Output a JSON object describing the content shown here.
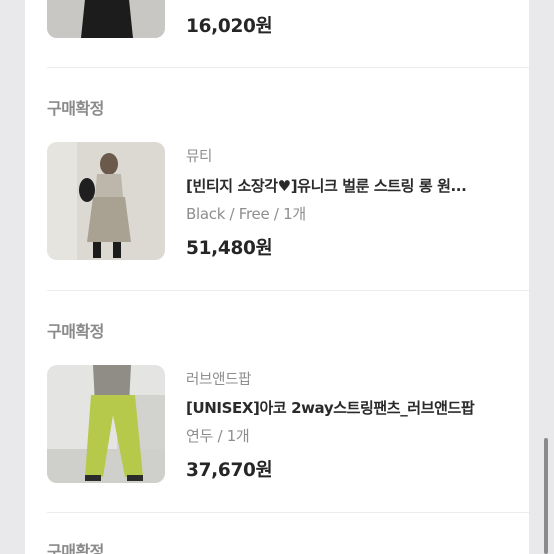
{
  "orders": [
    {
      "price": "16,020원"
    },
    {
      "status": "구매확정",
      "brand": "뮤티",
      "title": "[빈티지 소장각♥]유니크 벌룬 스트링 롱 원...",
      "option": "Black / Free /  1개",
      "price": "51,480원"
    },
    {
      "status": "구매확정",
      "brand": "러브앤드팝",
      "title": "[UNISEX]아코 2way스트링팬츠_러브앤드팝",
      "option": "연두 /  1개",
      "price": "37,670원"
    },
    {
      "status": "구매확정"
    }
  ]
}
